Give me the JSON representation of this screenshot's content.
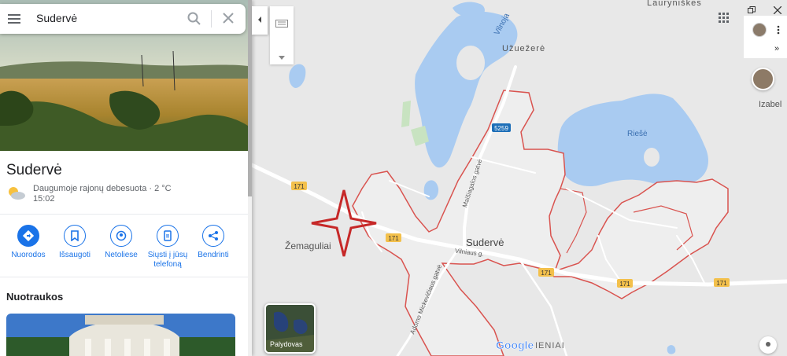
{
  "search": {
    "value": "Sudervė"
  },
  "place": {
    "title": "Sudervė",
    "weather": "Daugumoje rajonų debesuota · 2 °C",
    "time": "15:02"
  },
  "actions": [
    {
      "label": "Nuorodos",
      "icon": "directions-icon"
    },
    {
      "label": "Išsaugoti",
      "icon": "bookmark-icon"
    },
    {
      "label": "Netoliese",
      "icon": "nearby-icon"
    },
    {
      "label_line1": "Siųsti į jūsų",
      "label_line2": "telefoną",
      "icon": "phone-icon"
    },
    {
      "label": "Bendrinti",
      "icon": "share-icon"
    }
  ],
  "photos_section": {
    "title": "Nuotraukos"
  },
  "map": {
    "labels": {
      "village_main": "Sudervė",
      "village_west": "Žemaguliai",
      "village_ne": "Užuežerė",
      "village_top": "Lauryniškės",
      "village_right": "Izabel",
      "village_bottom": "IENIAI",
      "lake": "Riešė",
      "river": "Vilnoja",
      "street_1": "Maišiagalos gatvė",
      "street_2": "Vilniaus g.",
      "street_3": "Adomo Mickevičiaus gatvė"
    },
    "route_shields": {
      "a": "171",
      "b": "5259"
    },
    "logo": "Google",
    "satellite_label": "Palydovas"
  },
  "colors": {
    "accent": "#1a73e8",
    "water": "#a9cbf1",
    "boundary": "#d9534f",
    "marker": "#c62828",
    "road_shield": "#f3c04b"
  }
}
